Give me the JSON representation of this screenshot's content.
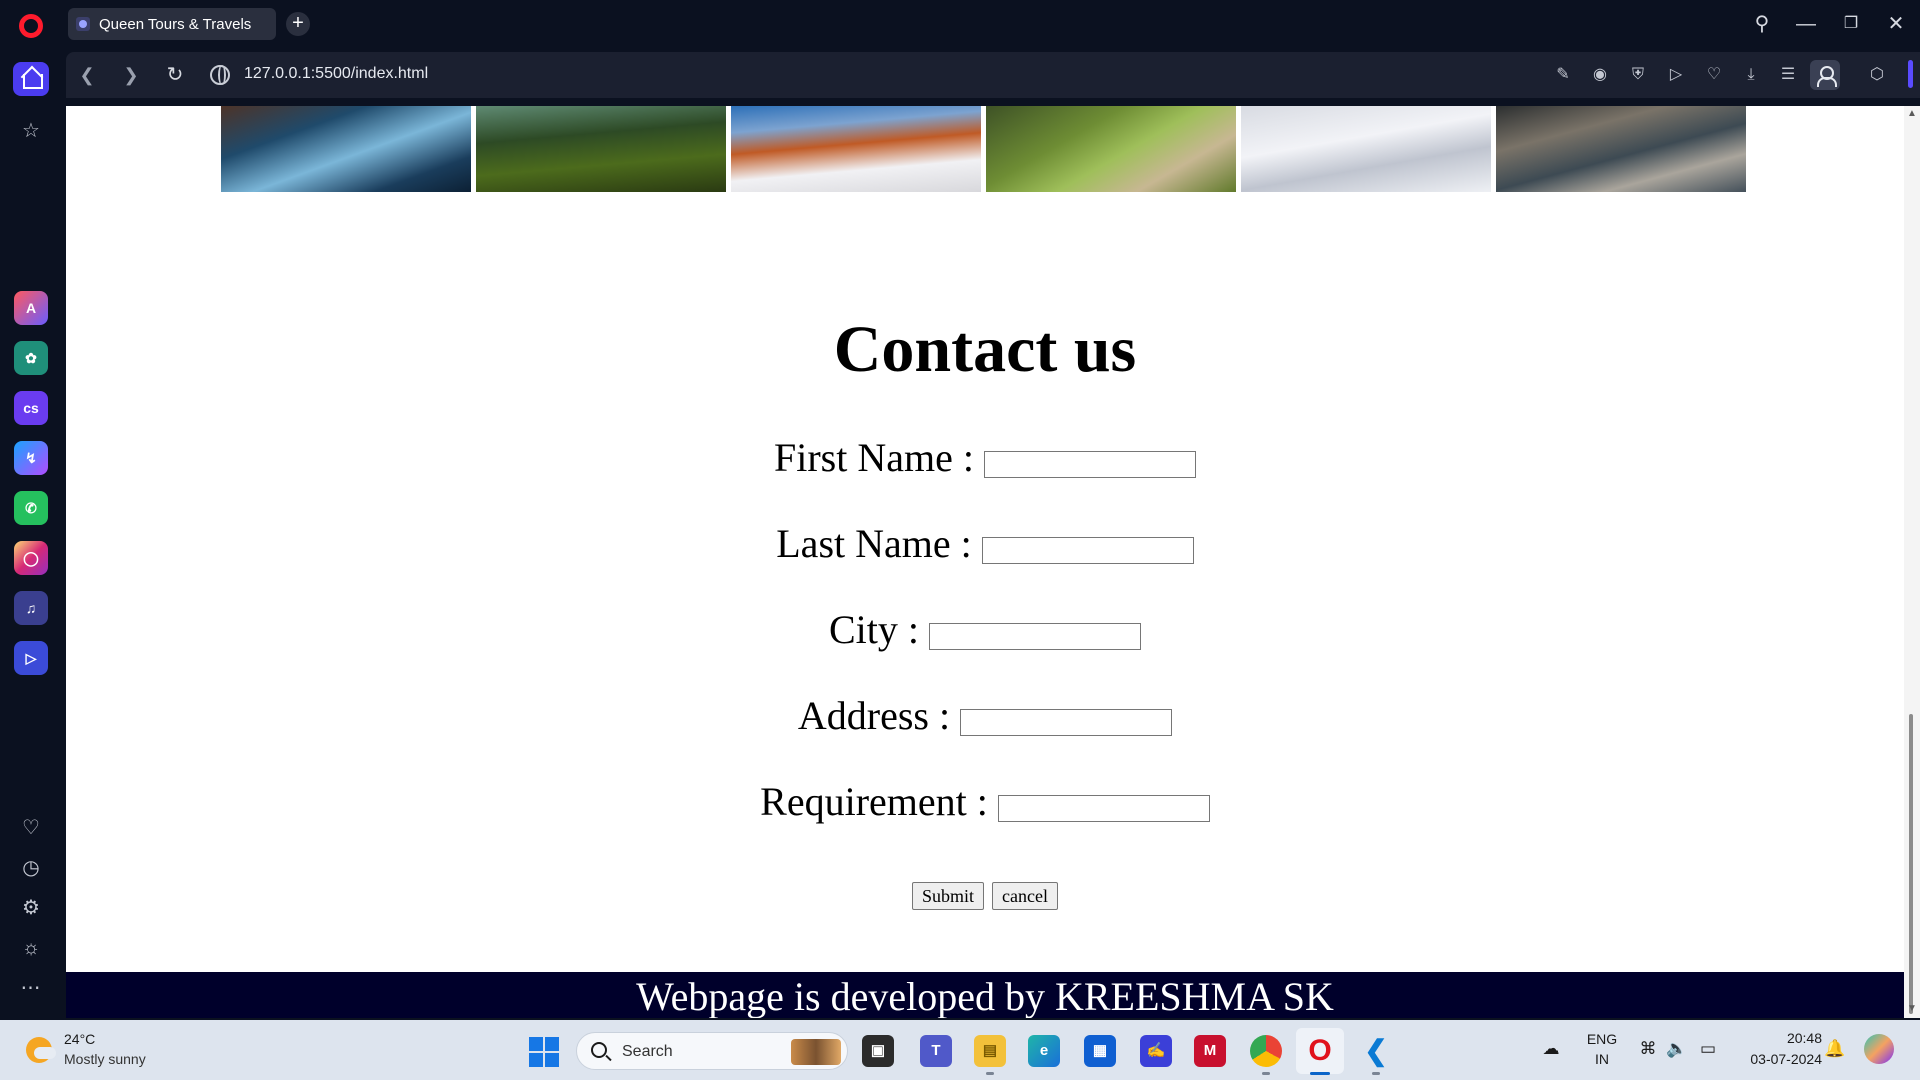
{
  "browser": {
    "tab_title": "Queen Tours & Travels",
    "url": "127.0.0.1:5500/index.html"
  },
  "page": {
    "title": "Contact us",
    "fields": [
      {
        "label": "First Name :",
        "value": ""
      },
      {
        "label": "Last Name :",
        "value": ""
      },
      {
        "label": "City :",
        "value": ""
      },
      {
        "label": "Address :",
        "value": ""
      },
      {
        "label": "Requirement :",
        "value": ""
      }
    ],
    "submit_label": "Submit",
    "cancel_label": "cancel",
    "footer": "Webpage is developed by KREESHMA SK"
  },
  "taskbar": {
    "weather_temp": "24°C",
    "weather_desc": "Mostly sunny",
    "search_placeholder": "Search",
    "language_line1": "ENG",
    "language_line2": "IN",
    "time": "20:48",
    "date": "03-07-2024"
  },
  "colors": {
    "opera_red": "#ff1b2d",
    "accent": "#4b3cf0",
    "footer_bg": "#00002b"
  }
}
